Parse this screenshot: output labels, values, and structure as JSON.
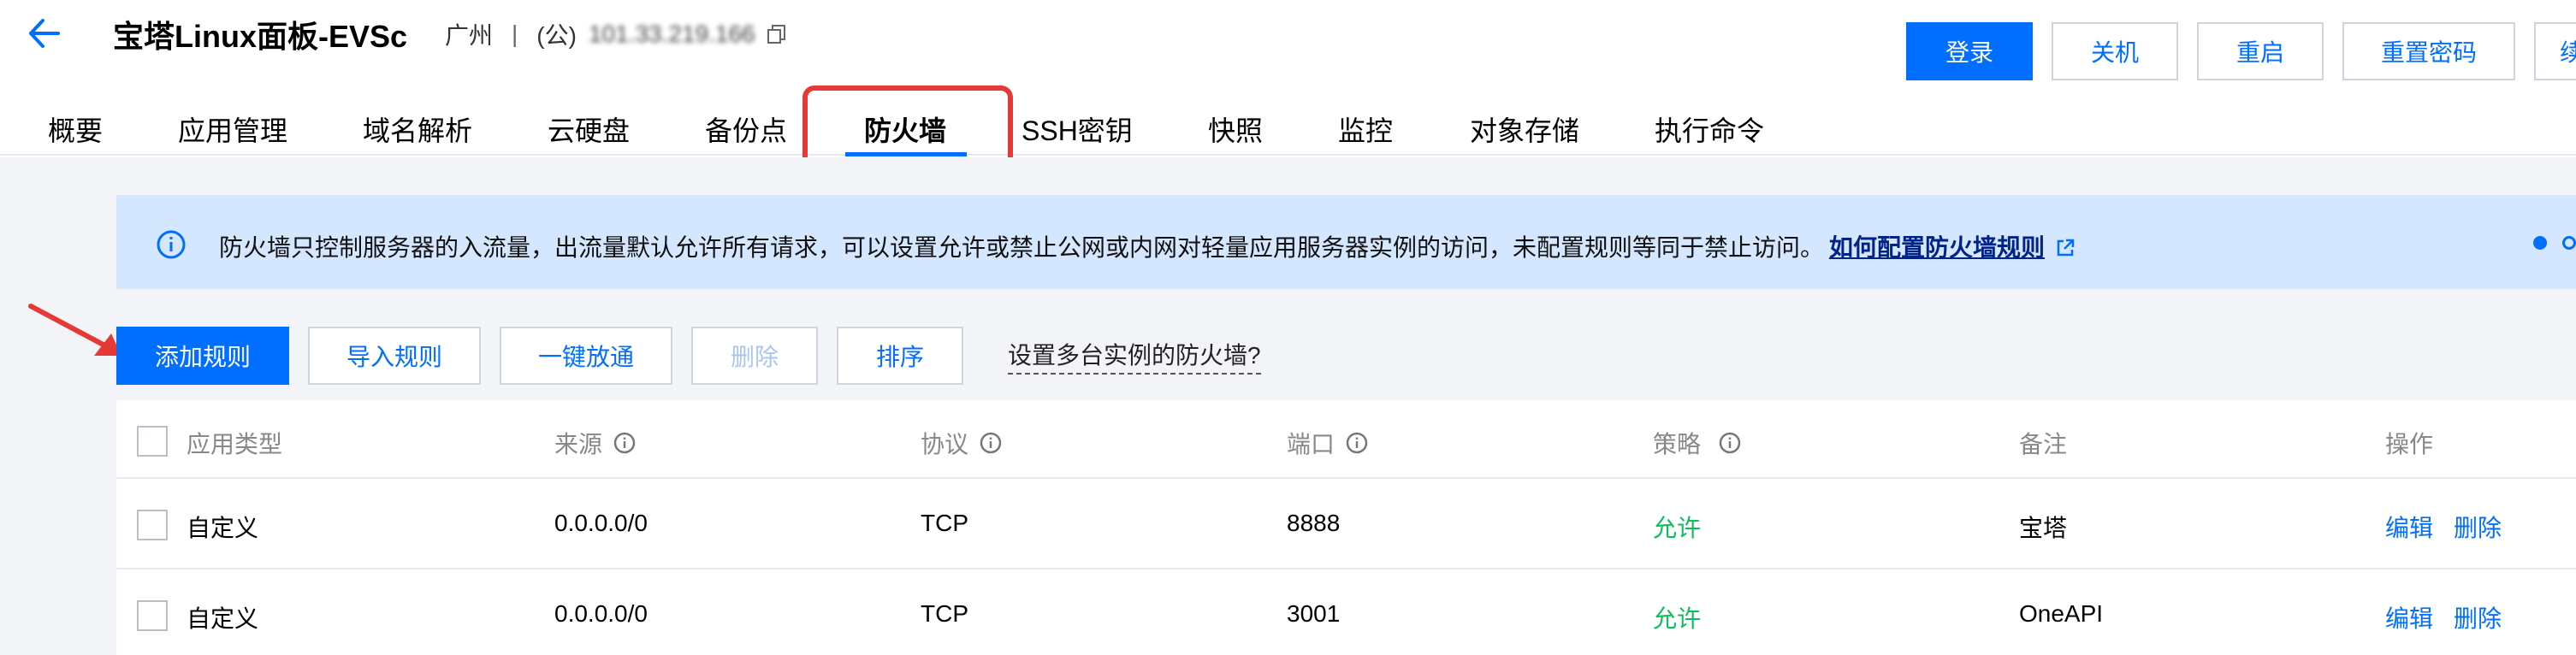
{
  "header": {
    "instance_name": "宝塔Linux面板-EVSc",
    "region": "广州",
    "separator": "|",
    "ip_label": "(公)",
    "ip_value": "101.33.219.166",
    "actions": {
      "login": "登录",
      "shutdown": "关机",
      "restart": "重启",
      "reset_password": "重置密码",
      "more": "续"
    }
  },
  "tabs": [
    {
      "label": "概要"
    },
    {
      "label": "应用管理"
    },
    {
      "label": "域名解析"
    },
    {
      "label": "云硬盘"
    },
    {
      "label": "备份点"
    },
    {
      "label": "防火墙",
      "active": true
    },
    {
      "label": "SSH密钥"
    },
    {
      "label": "快照"
    },
    {
      "label": "监控"
    },
    {
      "label": "对象存储"
    },
    {
      "label": "执行命令"
    }
  ],
  "notice": {
    "text": "防火墙只控制服务器的入流量，出流量默认允许所有请求，可以设置允许或禁止公网或内网对轻量应用服务器实例的访问，未配置规则等同于禁止访问。",
    "link": "如何配置防火墙规则"
  },
  "toolbar": {
    "add_rule": "添加规则",
    "import_rules": "导入规则",
    "one_click_release": "一键放通",
    "delete": "删除",
    "sort": "排序",
    "multi_instance_link": "设置多台实例的防火墙?"
  },
  "table": {
    "columns": [
      "应用类型",
      "来源",
      "协议",
      "端口",
      "策略",
      "备注",
      "操作"
    ],
    "rows": [
      {
        "type": "自定义",
        "source": "0.0.0.0/0",
        "protocol": "TCP",
        "port": "8888",
        "policy": "允许",
        "note": "宝塔",
        "edit": "编辑",
        "delete": "删除"
      },
      {
        "type": "自定义",
        "source": "0.0.0.0/0",
        "protocol": "TCP",
        "port": "3001",
        "policy": "允许",
        "note": "OneAPI",
        "edit": "编辑",
        "delete": "删除"
      }
    ]
  },
  "colors": {
    "primary": "#006eff",
    "allow": "#0abf5b",
    "notice_bg": "#d5e7ff",
    "highlight": "#e53935"
  },
  "icons": [
    "back-arrow-icon",
    "copy-icon",
    "info-icon",
    "external-link-icon",
    "help-circle-icon",
    "annotation-arrow-icon"
  ]
}
